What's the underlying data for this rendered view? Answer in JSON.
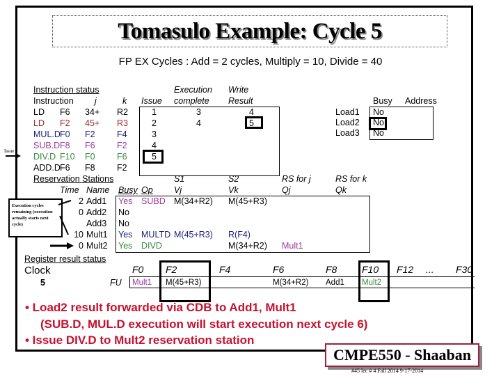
{
  "slide": {
    "title": "Tomasulo Example:   Cycle 5",
    "subtitle": "FP EX Cycles :  Add = 2 cycles, Multiply = 10, Divide = 40"
  },
  "instruction_status": {
    "section_label": "Instruction status",
    "headers": {
      "instruction": "Instruction",
      "j": "j",
      "k": "k",
      "issue": "Issue",
      "exec_top": "Execution",
      "exec_bottom": "complete",
      "write_top": "Write",
      "write_bottom": "Result"
    },
    "rows": [
      {
        "op": "LD",
        "dest": "F6",
        "j": "34+",
        "k": "R2",
        "issue": "1",
        "exec": "3",
        "write": "4",
        "color": "#000000"
      },
      {
        "op": "LD",
        "dest": "F2",
        "j": "45+",
        "k": "R3",
        "issue": "2",
        "exec": "4",
        "write": "5",
        "color": "#a52a2a"
      },
      {
        "op": "MUL.D",
        "dest": "F0",
        "j": "F2",
        "k": "F4",
        "issue": "3",
        "exec": "",
        "write": "",
        "color": "#1a237e"
      },
      {
        "op": "SUB.D",
        "dest": "F8",
        "j": "F6",
        "k": "F2",
        "issue": "4",
        "exec": "",
        "write": "",
        "color": "#9c3a9c"
      },
      {
        "op": "DIV.D",
        "dest": "F10",
        "j": "F0",
        "k": "F6",
        "issue": "5",
        "exec": "",
        "write": "",
        "color": "#3b8a3b"
      },
      {
        "op": "ADD.D",
        "dest": "F6",
        "j": "F8",
        "k": "F2",
        "issue": "",
        "exec": "",
        "write": "",
        "color": "#000000"
      }
    ],
    "issue_pointer_label": "Issue"
  },
  "load_buffers": {
    "headers": {
      "busy": "Busy",
      "address": "Address"
    },
    "rows": [
      {
        "name": "Load1",
        "busy": "No",
        "address": ""
      },
      {
        "name": "Load2",
        "busy": "No",
        "address": ""
      },
      {
        "name": "Load3",
        "busy": "No",
        "address": ""
      }
    ]
  },
  "reservation_stations": {
    "section_label": "Reservation Stations",
    "headers_top": {
      "s1": "S1",
      "s2": "S2",
      "qj": "RS for j",
      "qk": "RS for k"
    },
    "headers": {
      "time": "Time",
      "name": "Name",
      "busy": "Busy",
      "op": "Op",
      "vj": "Vj",
      "vk": "Vk",
      "qj": "Qj",
      "qk": "Qk"
    },
    "rows": [
      {
        "time": "2",
        "name": "Add1",
        "busy": "Yes",
        "op": "SUBD",
        "vj": "M(34+R2)",
        "vk": "M(45+R3)",
        "qj": "",
        "qk": "",
        "color": "#9c3a9c"
      },
      {
        "time": "0",
        "name": "Add2",
        "busy": "No",
        "op": "",
        "vj": "",
        "vk": "",
        "qj": "",
        "qk": "",
        "color": "#000000"
      },
      {
        "time": "",
        "name": "Add3",
        "busy": "No",
        "op": "",
        "vj": "",
        "vk": "",
        "qj": "",
        "qk": "",
        "color": "#000000"
      },
      {
        "time": "10",
        "name": "Mult1",
        "busy": "Yes",
        "op": "MULTD",
        "vj": "M(45+R3)",
        "vk": "R(F4)",
        "qj": "",
        "qk": "",
        "color": "#1a237e"
      },
      {
        "time": "0",
        "name": "Mult2",
        "busy": "Yes",
        "op": "DIVD",
        "vj": "",
        "vk": "M(34+R2)",
        "qj": "Mult1",
        "qk": "",
        "color": "#3b8a3b"
      }
    ],
    "note": "Execution cycles remaining (execution actually starts next cycle)"
  },
  "register_status": {
    "section_label": "Register result status",
    "clock_label": "Clock",
    "clock_value": "5",
    "fu_label": "FU",
    "registers": [
      {
        "name": "F0",
        "value": "Mult1",
        "color": "#9c3a9c"
      },
      {
        "name": "F2",
        "value": "M(45+R3)",
        "color": "#000000"
      },
      {
        "name": "F4",
        "value": "",
        "color": "#000000"
      },
      {
        "name": "F6",
        "value": "M(34+R2)",
        "color": "#000000"
      },
      {
        "name": "F8",
        "value": "Add1",
        "color": "#000000"
      },
      {
        "name": "F10",
        "value": "Mult2",
        "color": "#3b8a3b"
      },
      {
        "name": "F12",
        "value": "",
        "color": "#000000"
      },
      {
        "name": "...",
        "value": "",
        "color": "#000000"
      },
      {
        "name": "F30",
        "value": "",
        "color": "#000000"
      }
    ]
  },
  "notes": {
    "bullet1": "• Load2  result forwarded via  CDB  to  Add1,  Mult1",
    "bullet1_sub": "(SUB.D, MUL.D execution will start execution next cycle 6)",
    "bullet2": "• Issue DIV.D to Mult2 reservation station"
  },
  "footer": {
    "course": "CMPE550 - Shaaban",
    "slide_info": "#45  lec # 4 Fall 2014   9-17-2014"
  }
}
